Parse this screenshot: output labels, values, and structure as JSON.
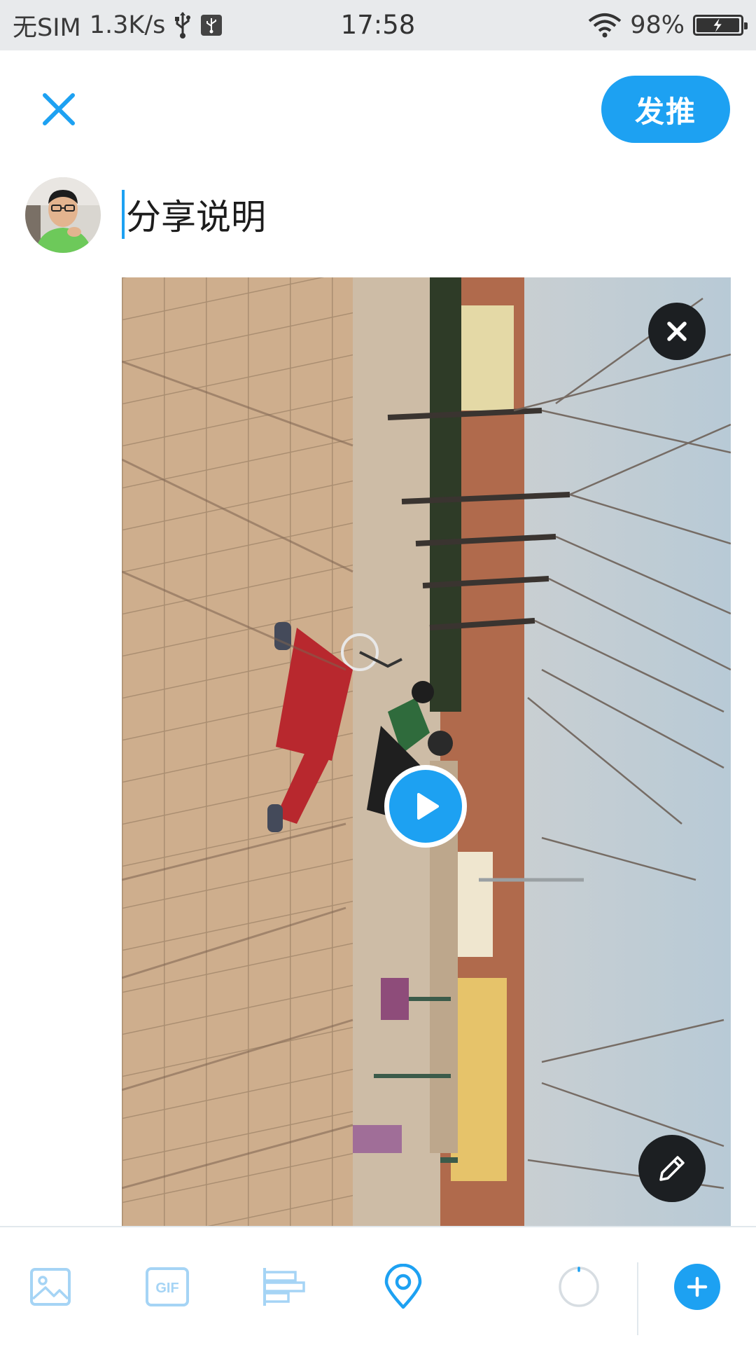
{
  "status_bar": {
    "carrier": "无SIM",
    "net_speed": "1.3K/s",
    "time": "17:58",
    "battery": "98%",
    "battery_level": 0.98,
    "icons": [
      "usb-icon",
      "usb-debug-icon",
      "wifi-icon",
      "battery-charging-icon"
    ]
  },
  "header": {
    "close_icon": "close-icon",
    "tweet_label": "发推"
  },
  "composer": {
    "placeholder": "分享说明",
    "avatar": "user-avatar"
  },
  "media": {
    "type": "video",
    "remove_icon": "close-icon",
    "play_icon": "play-icon",
    "edit_icon": "pencil-icon"
  },
  "toolbar": {
    "items": [
      "image-icon",
      "gif-icon",
      "poll-icon",
      "location-icon"
    ],
    "gif_label": "GIF",
    "char_counter_icon": "progress-ring-icon",
    "add_icon": "plus-icon"
  },
  "colors": {
    "accent": "#1da1f2",
    "toolbar_inactive": "#a5d4f5",
    "status_bar_bg": "#e8eaec"
  }
}
